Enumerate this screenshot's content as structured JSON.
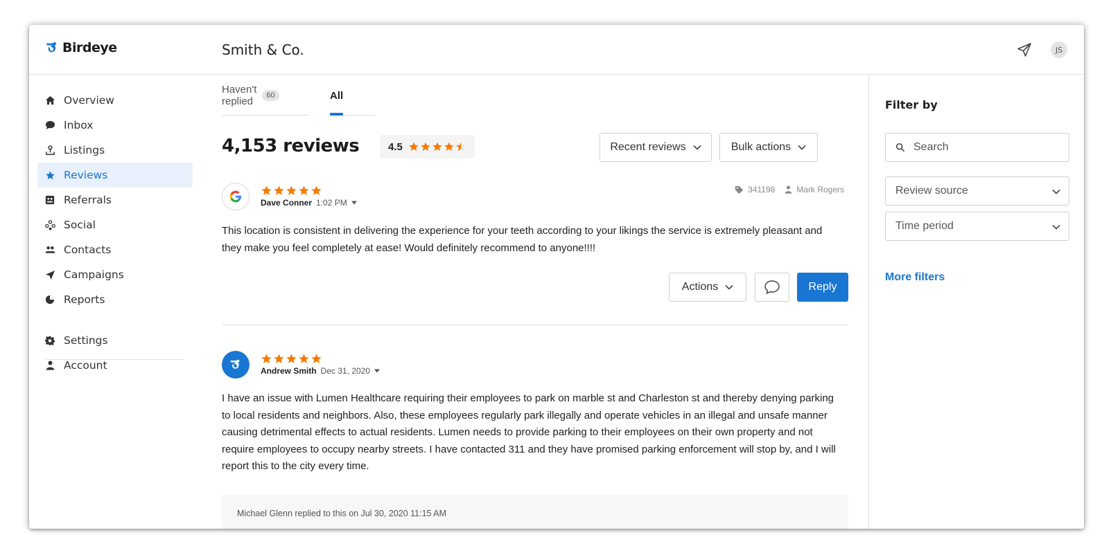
{
  "header": {
    "brand": "Birdeye",
    "business_name": "Smith & Co.",
    "avatar_initials": "JS"
  },
  "sidebar": {
    "items": [
      {
        "label": "Overview",
        "icon": "home-icon"
      },
      {
        "label": "Inbox",
        "icon": "chat-icon"
      },
      {
        "label": "Listings",
        "icon": "pin-icon"
      },
      {
        "label": "Reviews",
        "icon": "star-icon",
        "active": true
      },
      {
        "label": "Referrals",
        "icon": "referral-icon"
      },
      {
        "label": "Social",
        "icon": "social-icon"
      },
      {
        "label": "Contacts",
        "icon": "contacts-icon"
      },
      {
        "label": "Campaigns",
        "icon": "campaign-icon"
      },
      {
        "label": "Reports",
        "icon": "reports-icon"
      },
      {
        "label": "Settings",
        "icon": "gear-icon"
      },
      {
        "label": "Account",
        "icon": "person-icon"
      }
    ]
  },
  "tabs": {
    "not_replied_label": "Haven't replied",
    "not_replied_count": "60",
    "all_label": "All"
  },
  "summary": {
    "count_label": "4,153 reviews",
    "avg_rating": "4.5",
    "avg_stars": 4.5
  },
  "toolbar": {
    "sort_label": "Recent reviews",
    "bulk_label": "Bulk actions"
  },
  "reviews": [
    {
      "source": "google",
      "stars": 5,
      "author": "Dave Conner",
      "time": "1:02 PM",
      "tag_id": "341198",
      "assignee": "Mark Rogers",
      "text": "This location is consistent in delivering the experience for your teeth according to your likings the service is extremely pleasant and they make you feel completely at ease! Would definitely recommend to anyone!!!!",
      "actions_label": "Actions",
      "reply_label": "Reply"
    },
    {
      "source": "birdeye",
      "stars": 5,
      "author": "Andrew Smith",
      "time": "Dec 31, 2020",
      "text": "I have an issue with Lumen Healthcare requiring their employees to park on marble st and Charleston st and thereby denying parking to local residents and neighbors. Also, these employees regularly park illegally and operate vehicles in an illegal and unsafe manner causing detrimental effects to actual residents. Lumen needs to provide parking to their employees on their own property and not require employees to occupy nearby streets. I have contacted 311 and they have promised parking enforcement will stop by, and I will report this to the city every time.",
      "reply_note": "Michael Glenn replied to this on Jul 30, 2020 11:15 AM"
    }
  ],
  "filter": {
    "title": "Filter by",
    "search_placeholder": "Search",
    "review_source_label": "Review source",
    "time_period_label": "Time period",
    "more_filters_label": "More filters"
  },
  "colors": {
    "accent": "#1976d2",
    "star": "#f57c00",
    "star_empty": "#e6e6e6",
    "active_nav_bg": "#e8f1fb"
  }
}
